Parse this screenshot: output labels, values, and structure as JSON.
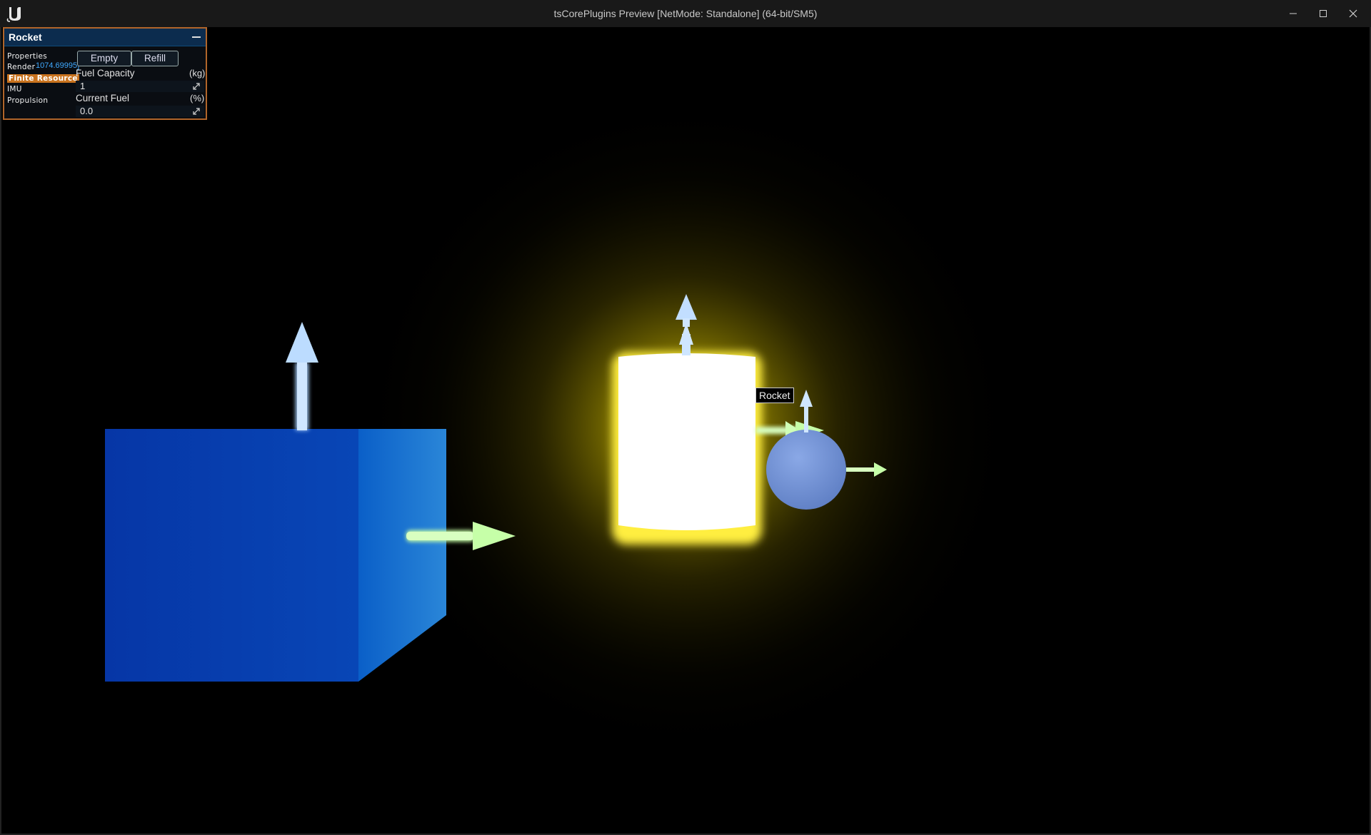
{
  "window": {
    "title": "tsCorePlugins Preview [NetMode: Standalone]  (64-bit/SM5)",
    "logo": "unreal-engine-logo",
    "controls": [
      "minimize-icon",
      "maximize-icon",
      "close-icon"
    ]
  },
  "panel": {
    "title": "Rocket",
    "collapse_icon": "minus-icon",
    "nav": [
      {
        "label": "Properties"
      },
      {
        "label": "Render"
      },
      {
        "label": "Finite Resource",
        "active": true
      },
      {
        "label": "IMU"
      },
      {
        "label": "Propulsion"
      }
    ],
    "render_readout": "1074.69995]",
    "buttons": {
      "empty": "Empty",
      "refill": "Refill"
    },
    "fields": [
      {
        "label": "Fuel Capacity",
        "unit": "(kg)",
        "value": "1"
      },
      {
        "label": "Current Fuel",
        "unit": "(%)",
        "value": "0.0"
      }
    ],
    "accent_color": "#c9731f",
    "header_color": "#0c2c4e"
  },
  "scene": {
    "object_label": "Rocket",
    "objects": [
      "blue-cube",
      "glowing-yellow-cylinder",
      "blue-sphere"
    ],
    "axis_arrows": [
      "up-arrow",
      "forward-arrow"
    ],
    "glow_color": "#ffe600",
    "cube_color": "#0b47b8",
    "sphere_color": "#6f8ed4"
  }
}
